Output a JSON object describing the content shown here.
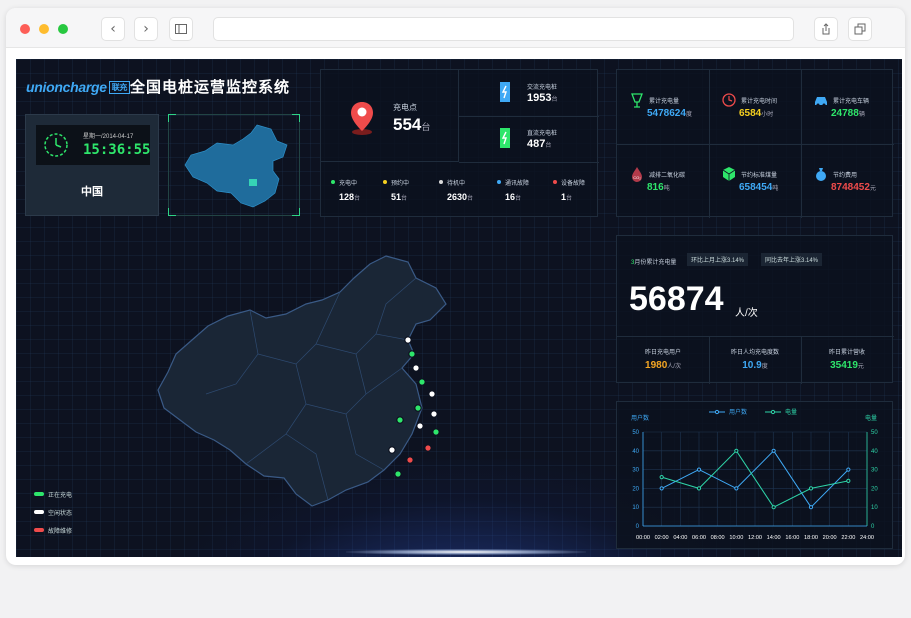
{
  "dashboard": {
    "logo": "unioncharge",
    "logo_tag": "联充",
    "title": "全国电桩运营监控系统",
    "date": "星期一/2014-04-17",
    "time": "15:36:55",
    "country": "中国"
  },
  "charging": {
    "label": "充电点",
    "value": "554",
    "unit": "台",
    "ac_label": "交流充电桩",
    "ac_value": "1953",
    "ac_unit": "台",
    "dc_label": "直流充电桩",
    "dc_value": "487",
    "dc_unit": "台"
  },
  "statuses": [
    {
      "label": "充电中",
      "value": "128",
      "unit": "台",
      "color": "#2ee66b"
    },
    {
      "label": "预约中",
      "value": "51",
      "unit": "台",
      "color": "#f5d020"
    },
    {
      "label": "待机中",
      "value": "2630",
      "unit": "台",
      "color": "#d9d9d9"
    },
    {
      "label": "通讯故障",
      "value": "16",
      "unit": "台",
      "color": "#3fa9f5"
    },
    {
      "label": "设备故障",
      "value": "1",
      "unit": "台",
      "color": "#ef4b4b"
    }
  ],
  "totals": [
    {
      "label": "累计充电量",
      "value": "5478624",
      "unit": "度",
      "color": "#3fa9f5",
      "icon": "cup-icon"
    },
    {
      "label": "累计充电时间",
      "value": "6584",
      "unit": "小时",
      "color": "#f5d020",
      "icon": "clock-icon"
    },
    {
      "label": "累计充电车辆",
      "value": "24788",
      "unit": "辆",
      "color": "#2ee66b",
      "icon": "car-icon"
    },
    {
      "label": "减排二氧化碳",
      "value": "816",
      "unit": "吨",
      "color": "#2ee66b",
      "icon": "co2-drop-icon"
    },
    {
      "label": "节约标准煤量",
      "value": "658454",
      "unit": "吨",
      "color": "#3fa9f5",
      "icon": "cube-icon"
    },
    {
      "label": "节约费用",
      "value": "8748452",
      "unit": "元",
      "color": "#ef4b4b",
      "icon": "money-bag-icon"
    }
  ],
  "monthly": {
    "label_prefix": "3",
    "label": "月份累计充电量",
    "mom": "环比上月上涨3.14%",
    "yoy": "同比去年上涨3.14%",
    "value": "56874",
    "unit": "人/次",
    "yesterday": [
      {
        "label": "昨日充电用户",
        "value": "1980",
        "unit": "人/次",
        "color": "#f5a623"
      },
      {
        "label": "昨日人均充电度数",
        "value": "10.9",
        "unit": "度",
        "color": "#3fa9f5"
      },
      {
        "label": "昨日累计营收",
        "value": "35419",
        "unit": "元",
        "color": "#2ee66b"
      }
    ]
  },
  "map_legend": [
    {
      "label": "正在充电",
      "color": "#2ee66b"
    },
    {
      "label": "空闲状态",
      "color": "#ffffff"
    },
    {
      "label": "故障维修",
      "color": "#ef4b4b"
    }
  ],
  "chart_data": {
    "type": "line",
    "x": [
      "00:00",
      "02:00",
      "04:00",
      "06:00",
      "08:00",
      "10:00",
      "12:00",
      "14:00",
      "16:00",
      "18:00",
      "20:00",
      "22:00",
      "24:00"
    ],
    "ylabel_left": "用户数",
    "ylabel_right": "电量",
    "ylim": [
      0,
      50
    ],
    "yticks": [
      0,
      10,
      20,
      30,
      40,
      50
    ],
    "grid": true,
    "legend": "top-center",
    "series": [
      {
        "name": "用户数",
        "color": "#3fa9f5",
        "points": [
          [
            "02:00",
            20
          ],
          [
            "06:00",
            30
          ],
          [
            "10:00",
            20
          ],
          [
            "14:00",
            40
          ],
          [
            "18:00",
            10
          ],
          [
            "22:00",
            30
          ]
        ]
      },
      {
        "name": "电量",
        "color": "#2ed4a8",
        "points": [
          [
            "02:00",
            26
          ],
          [
            "06:00",
            20
          ],
          [
            "10:00",
            40
          ],
          [
            "14:00",
            10
          ],
          [
            "18:00",
            20
          ],
          [
            "22:00",
            24
          ]
        ]
      }
    ]
  }
}
